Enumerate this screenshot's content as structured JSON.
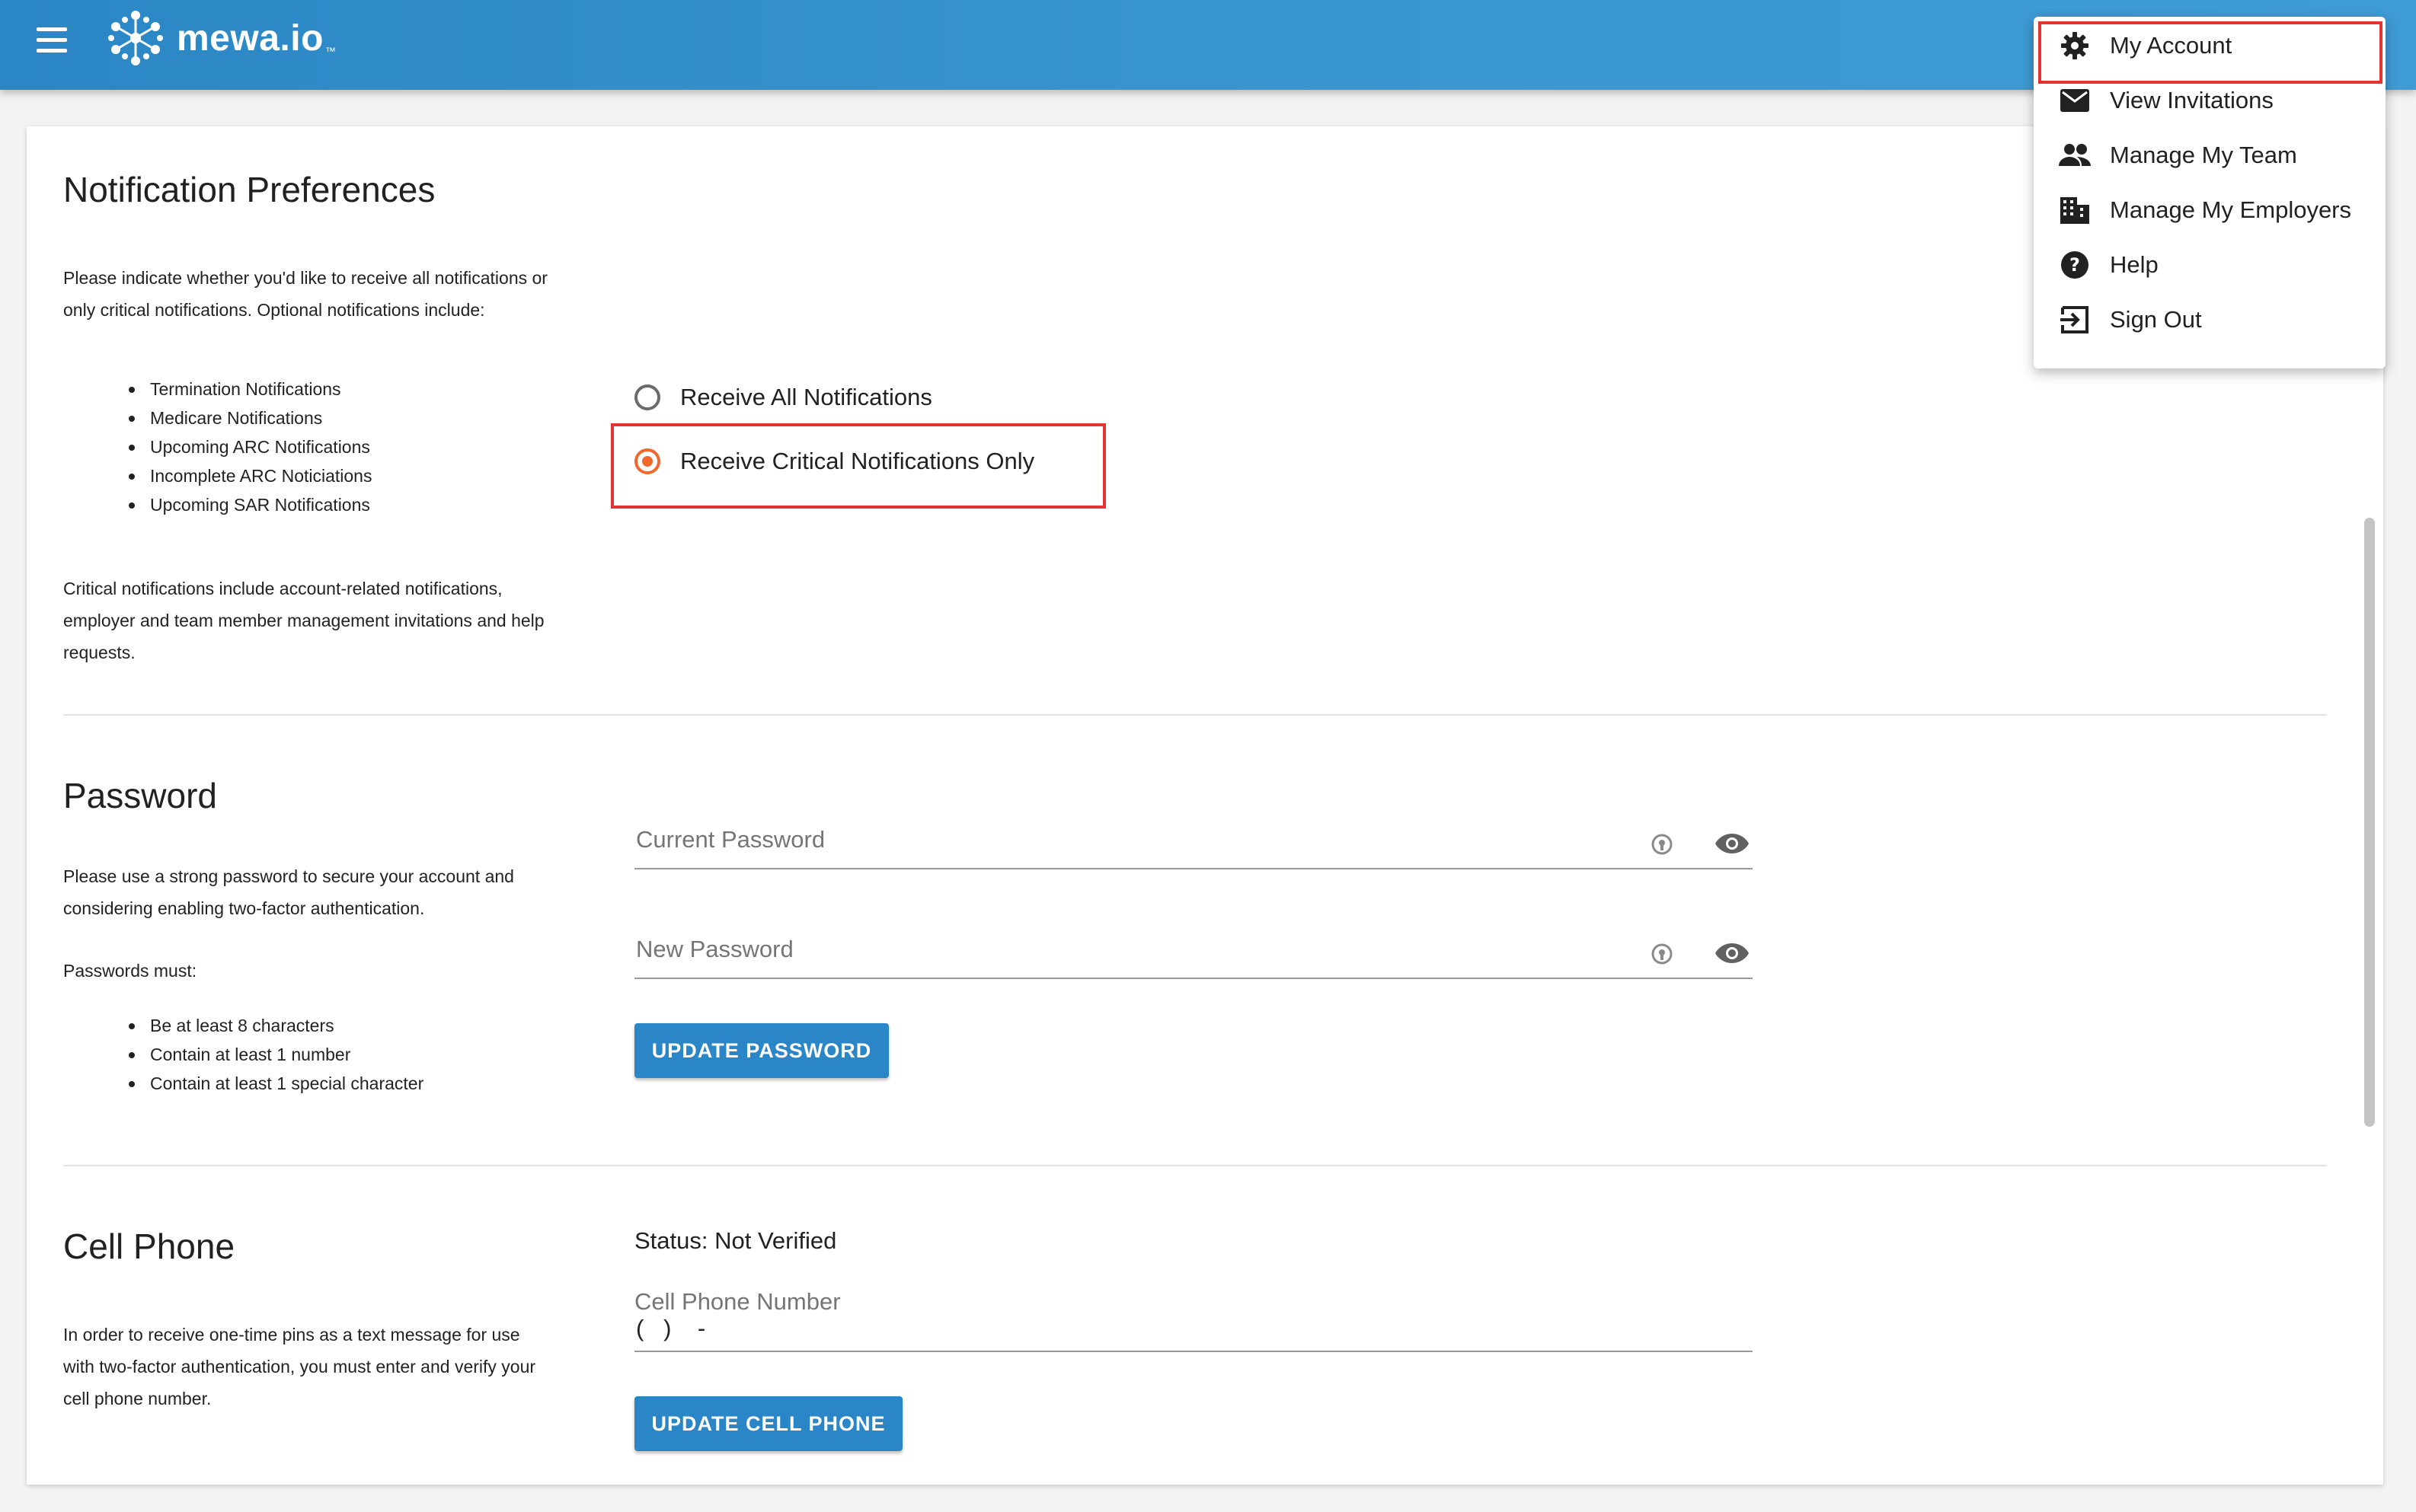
{
  "app": {
    "logo_text": "mewa.io",
    "logo_tm": "™"
  },
  "menu": {
    "items": [
      {
        "label": "My Account",
        "icon": "gear-icon"
      },
      {
        "label": "View Invitations",
        "icon": "envelope-icon"
      },
      {
        "label": "Manage My Team",
        "icon": "people-icon"
      },
      {
        "label": "Manage My Employers",
        "icon": "building-icon"
      },
      {
        "label": "Help",
        "icon": "help-icon"
      },
      {
        "label": "Sign Out",
        "icon": "sign-out-icon"
      }
    ],
    "highlighted": "My Account"
  },
  "notifications": {
    "title": "Notification Preferences",
    "intro_line1": "Please indicate whether you'd like to receive all notifications or",
    "intro_line2": "only critical notifications. Optional notifications include:",
    "optional": [
      "Termination Notifications",
      "Medicare Notifications",
      "Upcoming ARC Notifications",
      "Incomplete ARC Noticiations",
      "Upcoming SAR Notifications"
    ],
    "critical_line1": "Critical notifications include account-related notifications,",
    "critical_line2": "employer and team member management invitations and help",
    "critical_line3": "requests.",
    "option_all": "Receive All Notifications",
    "option_critical": "Receive Critical Notifications Only",
    "selected": "Receive Critical Notifications Only"
  },
  "password": {
    "title": "Password",
    "desc_line1": "Please use a strong password to secure your account and",
    "desc_line2": "considering enabling two-factor authentication.",
    "rules_heading": "Passwords must:",
    "rules": [
      "Be at least 8 characters",
      "Contain at least 1 number",
      "Contain at least 1 special character"
    ],
    "current_placeholder": "Current Password",
    "new_placeholder": "New Password",
    "button": "UPDATE PASSWORD"
  },
  "cell": {
    "title": "Cell Phone",
    "desc_line1": "In order to receive one-time pins as a text message for use",
    "desc_line2": "with two-factor authentication, you must enter and verify your",
    "desc_line3": "cell phone number.",
    "status": "Status: Not Verified",
    "label": "Cell Phone Number",
    "value": "(   )    -",
    "button": "UPDATE CELL PHONE"
  },
  "colors": {
    "topbar": "#3b97d0",
    "accent": "#f0692c",
    "button": "#2a86c6",
    "highlight": "#e33434"
  }
}
